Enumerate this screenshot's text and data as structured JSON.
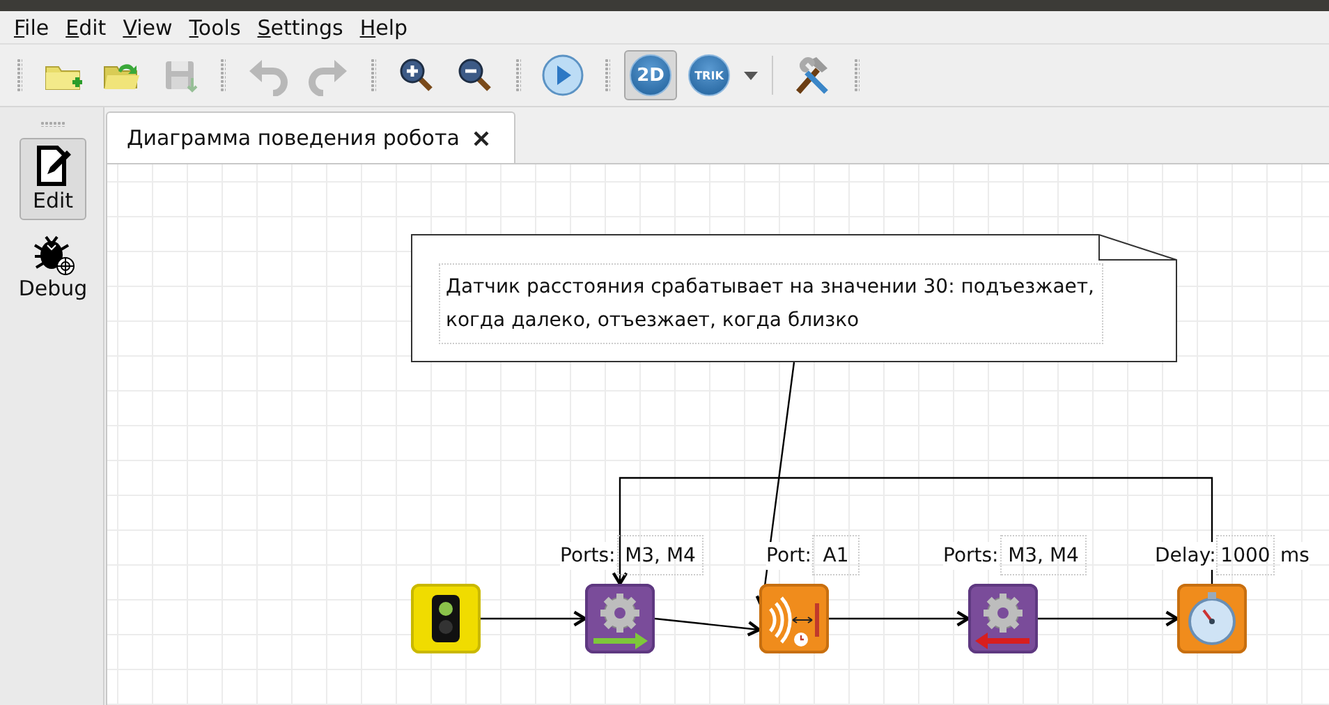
{
  "menu": [
    {
      "label": "File"
    },
    {
      "label": "Edit"
    },
    {
      "label": "View"
    },
    {
      "label": "Tools"
    },
    {
      "label": "Settings"
    },
    {
      "label": "Help"
    }
  ],
  "toolbar": [
    {
      "kind": "grip"
    },
    {
      "kind": "new",
      "disabled": false,
      "selected": false
    },
    {
      "kind": "open",
      "disabled": false,
      "selected": false
    },
    {
      "kind": "save",
      "disabled": true,
      "selected": false
    },
    {
      "kind": "grip"
    },
    {
      "kind": "undo",
      "disabled": true,
      "selected": false
    },
    {
      "kind": "redo",
      "disabled": true,
      "selected": false
    },
    {
      "kind": "grip"
    },
    {
      "kind": "zoomin",
      "disabled": false,
      "selected": false
    },
    {
      "kind": "zoomout",
      "disabled": false,
      "selected": false
    },
    {
      "kind": "grip"
    },
    {
      "kind": "run",
      "disabled": false,
      "selected": false
    },
    {
      "kind": "grip"
    },
    {
      "kind": "mode",
      "label": "2D",
      "disabled": false,
      "selected": true
    },
    {
      "kind": "mode",
      "label": "TRIK",
      "disabled": false,
      "selected": false
    },
    {
      "kind": "caret",
      "disabled": false,
      "selected": false
    },
    {
      "kind": "sep"
    },
    {
      "kind": "tools",
      "disabled": false,
      "selected": false
    },
    {
      "kind": "grip"
    }
  ],
  "dock": [
    {
      "label": "Edit",
      "kind": "edit",
      "selected": true
    },
    {
      "label": "Debug",
      "kind": "debug",
      "selected": false
    }
  ],
  "tabs": [
    {
      "label": "Диаграмма поведения робота",
      "selected": true
    }
  ],
  "diagram": {
    "note": "Датчик расстояния срабатывает на значении 30: подъезжает, когда далеко, отъезжает, когда близко",
    "blocks": [
      {
        "kind": "start"
      },
      {
        "kind": "motors-forward",
        "property": "Ports:",
        "value": "M3, M4"
      },
      {
        "kind": "sensor",
        "property": "Port:",
        "value": "A1"
      },
      {
        "kind": "motors-backward",
        "property": "Ports:",
        "value": "M3, M4"
      },
      {
        "kind": "timer",
        "property": "Delay:",
        "value": "1000",
        "unit": "ms"
      }
    ]
  }
}
